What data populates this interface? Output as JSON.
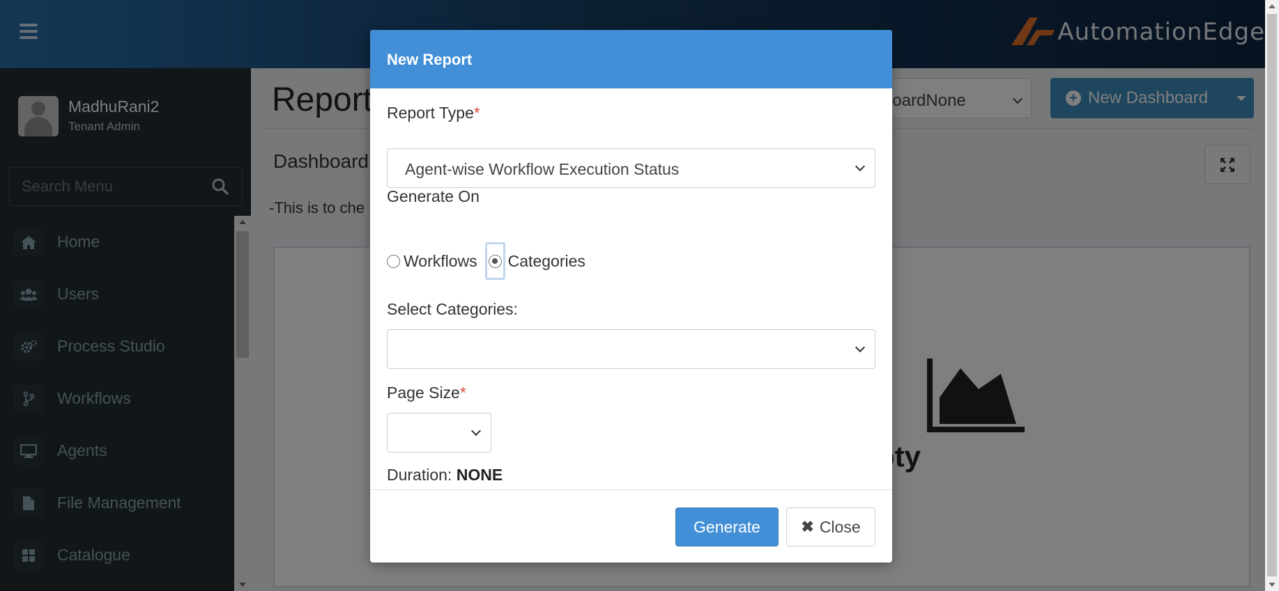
{
  "header": {
    "logo_text": "AutomationEdge",
    "accent": "#2a6fa8"
  },
  "sidebar": {
    "user": {
      "name": "MadhuRani2",
      "role": "Tenant Admin"
    },
    "search": {
      "placeholder": "Search Menu"
    },
    "items": [
      {
        "label": "Home",
        "icon": "home-icon"
      },
      {
        "label": "Users",
        "icon": "users-icon"
      },
      {
        "label": "Process Studio",
        "icon": "gears-icon"
      },
      {
        "label": "Workflows",
        "icon": "workflow-branch-icon"
      },
      {
        "label": "Agents",
        "icon": "monitor-icon"
      },
      {
        "label": "File Management",
        "icon": "file-icon"
      },
      {
        "label": "Catalogue",
        "icon": "grid-icon"
      }
    ]
  },
  "main": {
    "title": "Report",
    "dashboard_select": "boardNone",
    "new_dashboard_label": "New Dashboard",
    "dashboard_name": "Dashboard",
    "dashboard_desc": "-This is to che",
    "empty_text": "pty"
  },
  "modal": {
    "title": "New Report",
    "report_type_label": "Report Type",
    "report_type_value": "Agent-wise Workflow Execution Status",
    "generate_on_label": "Generate On",
    "options": {
      "workflows": "Workflows",
      "categories": "Categories"
    },
    "selected_option": "Categories",
    "select_categories_label": "Select Categories:",
    "select_categories_value": "",
    "page_size_label": "Page Size",
    "page_size_value": "",
    "duration_label": "Duration:",
    "duration_value": "NONE",
    "generate_label": "Generate",
    "close_label": "Close",
    "header_color": "#428fd7",
    "required_color": "#dd4b39"
  }
}
